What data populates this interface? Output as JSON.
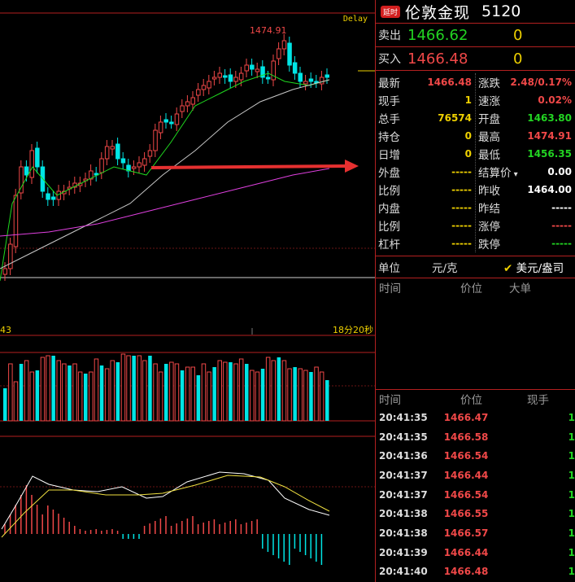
{
  "colors": {
    "up": "#f04848",
    "down": "#00e5e5",
    "ma5": "#ffffff",
    "ma10": "#1fd81f",
    "ma20": "#c8c8c8",
    "ma60": "#e040e0",
    "arrow": "#e53030",
    "grid": "#b32020",
    "dif": "#ffffff",
    "dea": "#f0e040"
  },
  "chart": {
    "delay_label": "Delay",
    "high_label": "1474.91",
    "time_left_label": "43",
    "time_right_label": "18分20秒"
  },
  "header": {
    "badge": "延时",
    "title": "伦敦金现",
    "code": "5120"
  },
  "quote": {
    "sell": {
      "label": "卖出",
      "price": "1466.62",
      "vol": "0"
    },
    "buy": {
      "label": "买入",
      "price": "1466.48",
      "vol": "0"
    }
  },
  "stats_left": [
    {
      "k": "最新",
      "v": "1466.48",
      "c": "red"
    },
    {
      "k": "现手",
      "v": "1",
      "c": "yel"
    },
    {
      "k": "总手",
      "v": "76574",
      "c": "yel"
    },
    {
      "k": "持仓",
      "v": "0",
      "c": "yel"
    },
    {
      "k": "日增",
      "v": "0",
      "c": "yel"
    },
    {
      "k": "外盘",
      "v": "-----",
      "c": "dash-y"
    },
    {
      "k": "比例",
      "v": "-----",
      "c": "dash-y"
    },
    {
      "k": "内盘",
      "v": "-----",
      "c": "dash-y"
    },
    {
      "k": "比例",
      "v": "-----",
      "c": "dash-y"
    },
    {
      "k": "杠杆",
      "v": "-----",
      "c": "dash-y"
    }
  ],
  "stats_right": [
    {
      "k": "涨跌",
      "v": "2.48/0.17%",
      "c": "red"
    },
    {
      "k": "速涨",
      "v": "0.02%",
      "c": "red"
    },
    {
      "k": "开盘",
      "v": "1463.80",
      "c": "green"
    },
    {
      "k": "最高",
      "v": "1474.91",
      "c": "red"
    },
    {
      "k": "最低",
      "v": "1456.35",
      "c": "green"
    },
    {
      "k": "结算价",
      "v": "0.00",
      "c": "wht",
      "dropdown": true
    },
    {
      "k": "昨收",
      "v": "1464.00",
      "c": "wht"
    },
    {
      "k": "昨结",
      "v": "-----",
      "c": "dash-w"
    },
    {
      "k": "涨停",
      "v": "-----",
      "c": "dash-r"
    },
    {
      "k": "跌停",
      "v": "-----",
      "c": "dash-g"
    }
  ],
  "units": {
    "label": "单位",
    "unit": "元/克",
    "check_label": "美元/盎司"
  },
  "big_orders_header": {
    "time": "时间",
    "price": "价位",
    "big": "大单"
  },
  "ticks_header": {
    "time": "时间",
    "price": "价位",
    "vol": "现手"
  },
  "ticks": [
    {
      "t": "20:41:35",
      "p": "1466.47",
      "q": "1"
    },
    {
      "t": "20:41:35",
      "p": "1466.58",
      "q": "1"
    },
    {
      "t": "20:41:36",
      "p": "1466.54",
      "q": "1"
    },
    {
      "t": "20:41:37",
      "p": "1466.44",
      "q": "1"
    },
    {
      "t": "20:41:37",
      "p": "1466.54",
      "q": "1"
    },
    {
      "t": "20:41:38",
      "p": "1466.55",
      "q": "1"
    },
    {
      "t": "20:41:38",
      "p": "1466.57",
      "q": "1"
    },
    {
      "t": "20:41:39",
      "p": "1466.44",
      "q": "1"
    },
    {
      "t": "20:41:40",
      "p": "1466.48",
      "q": "1"
    }
  ]
}
